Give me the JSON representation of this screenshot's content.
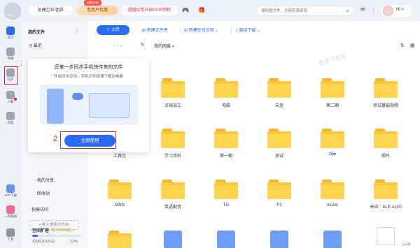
{
  "topbar": {
    "logo_text": "SVIP",
    "create_team": "创建企业/团队",
    "offer_tag": "仅剩¥68起",
    "new_user_offer": "老用户优惠",
    "svip_promo": "超值绘卷升级SVIP特权",
    "search_placeholder": "搜网盘文件、全网资源资讯",
    "greeting": "Hi >"
  },
  "rail": {
    "items": [
      {
        "label": "首页"
      },
      {
        "label": "传输"
      },
      {
        "label": "同步"
      },
      {
        "label": "AI看"
      },
      {
        "label": "消息"
      }
    ],
    "bottom": [
      {
        "label": "APP下载"
      },
      {
        "label": "一刻相册"
      },
      {
        "label": "工具"
      }
    ]
  },
  "markers": {
    "one": "1",
    "two": "2"
  },
  "sidebar": {
    "my_files": "我的文件",
    "recent": "最近",
    "my_share": "我的分享",
    "recycle_bin": "回收站",
    "quick_access": "快捷访问",
    "add_folder": "+ 拖入常用文件夹",
    "space_title": "空间扩容",
    "space_promo": "¥0.03/GB起 >",
    "usage": "133G/1031G",
    "usage_percent": "12%",
    "usage_fraction": 0.12
  },
  "toolbar": {
    "upload": "上传",
    "new_folder": "新建文件夹",
    "new_online_doc": "新建在线文档",
    "offline_download": "离线下载"
  },
  "nav": {
    "breadcrumb": "我的网盘 >",
    "watermark": "稳遂下载站"
  },
  "popup": {
    "title": "还差一步同步手机快传来的文件",
    "subtitle": "开启同步空间，手机文件极速下载到电脑",
    "button": "立即使用"
  },
  "grid": {
    "row1": [
      "文档加工",
      "电脑",
      "未连",
      "第二期",
      "测试基础视频"
    ],
    "row2": [
      "工具包",
      "学习资料",
      "第一期",
      "测试",
      "zijie",
      "照片"
    ],
    "row3": [
      "DWG",
      "英语配音",
      "TG",
      "P1",
      "music",
      "来自：ALP-AL00"
    ]
  },
  "footer": {
    "item_count": "24项"
  },
  "colors": {
    "accent": "#2b6bf3",
    "marker": "#e0242e",
    "folder": "#ffd54f"
  }
}
